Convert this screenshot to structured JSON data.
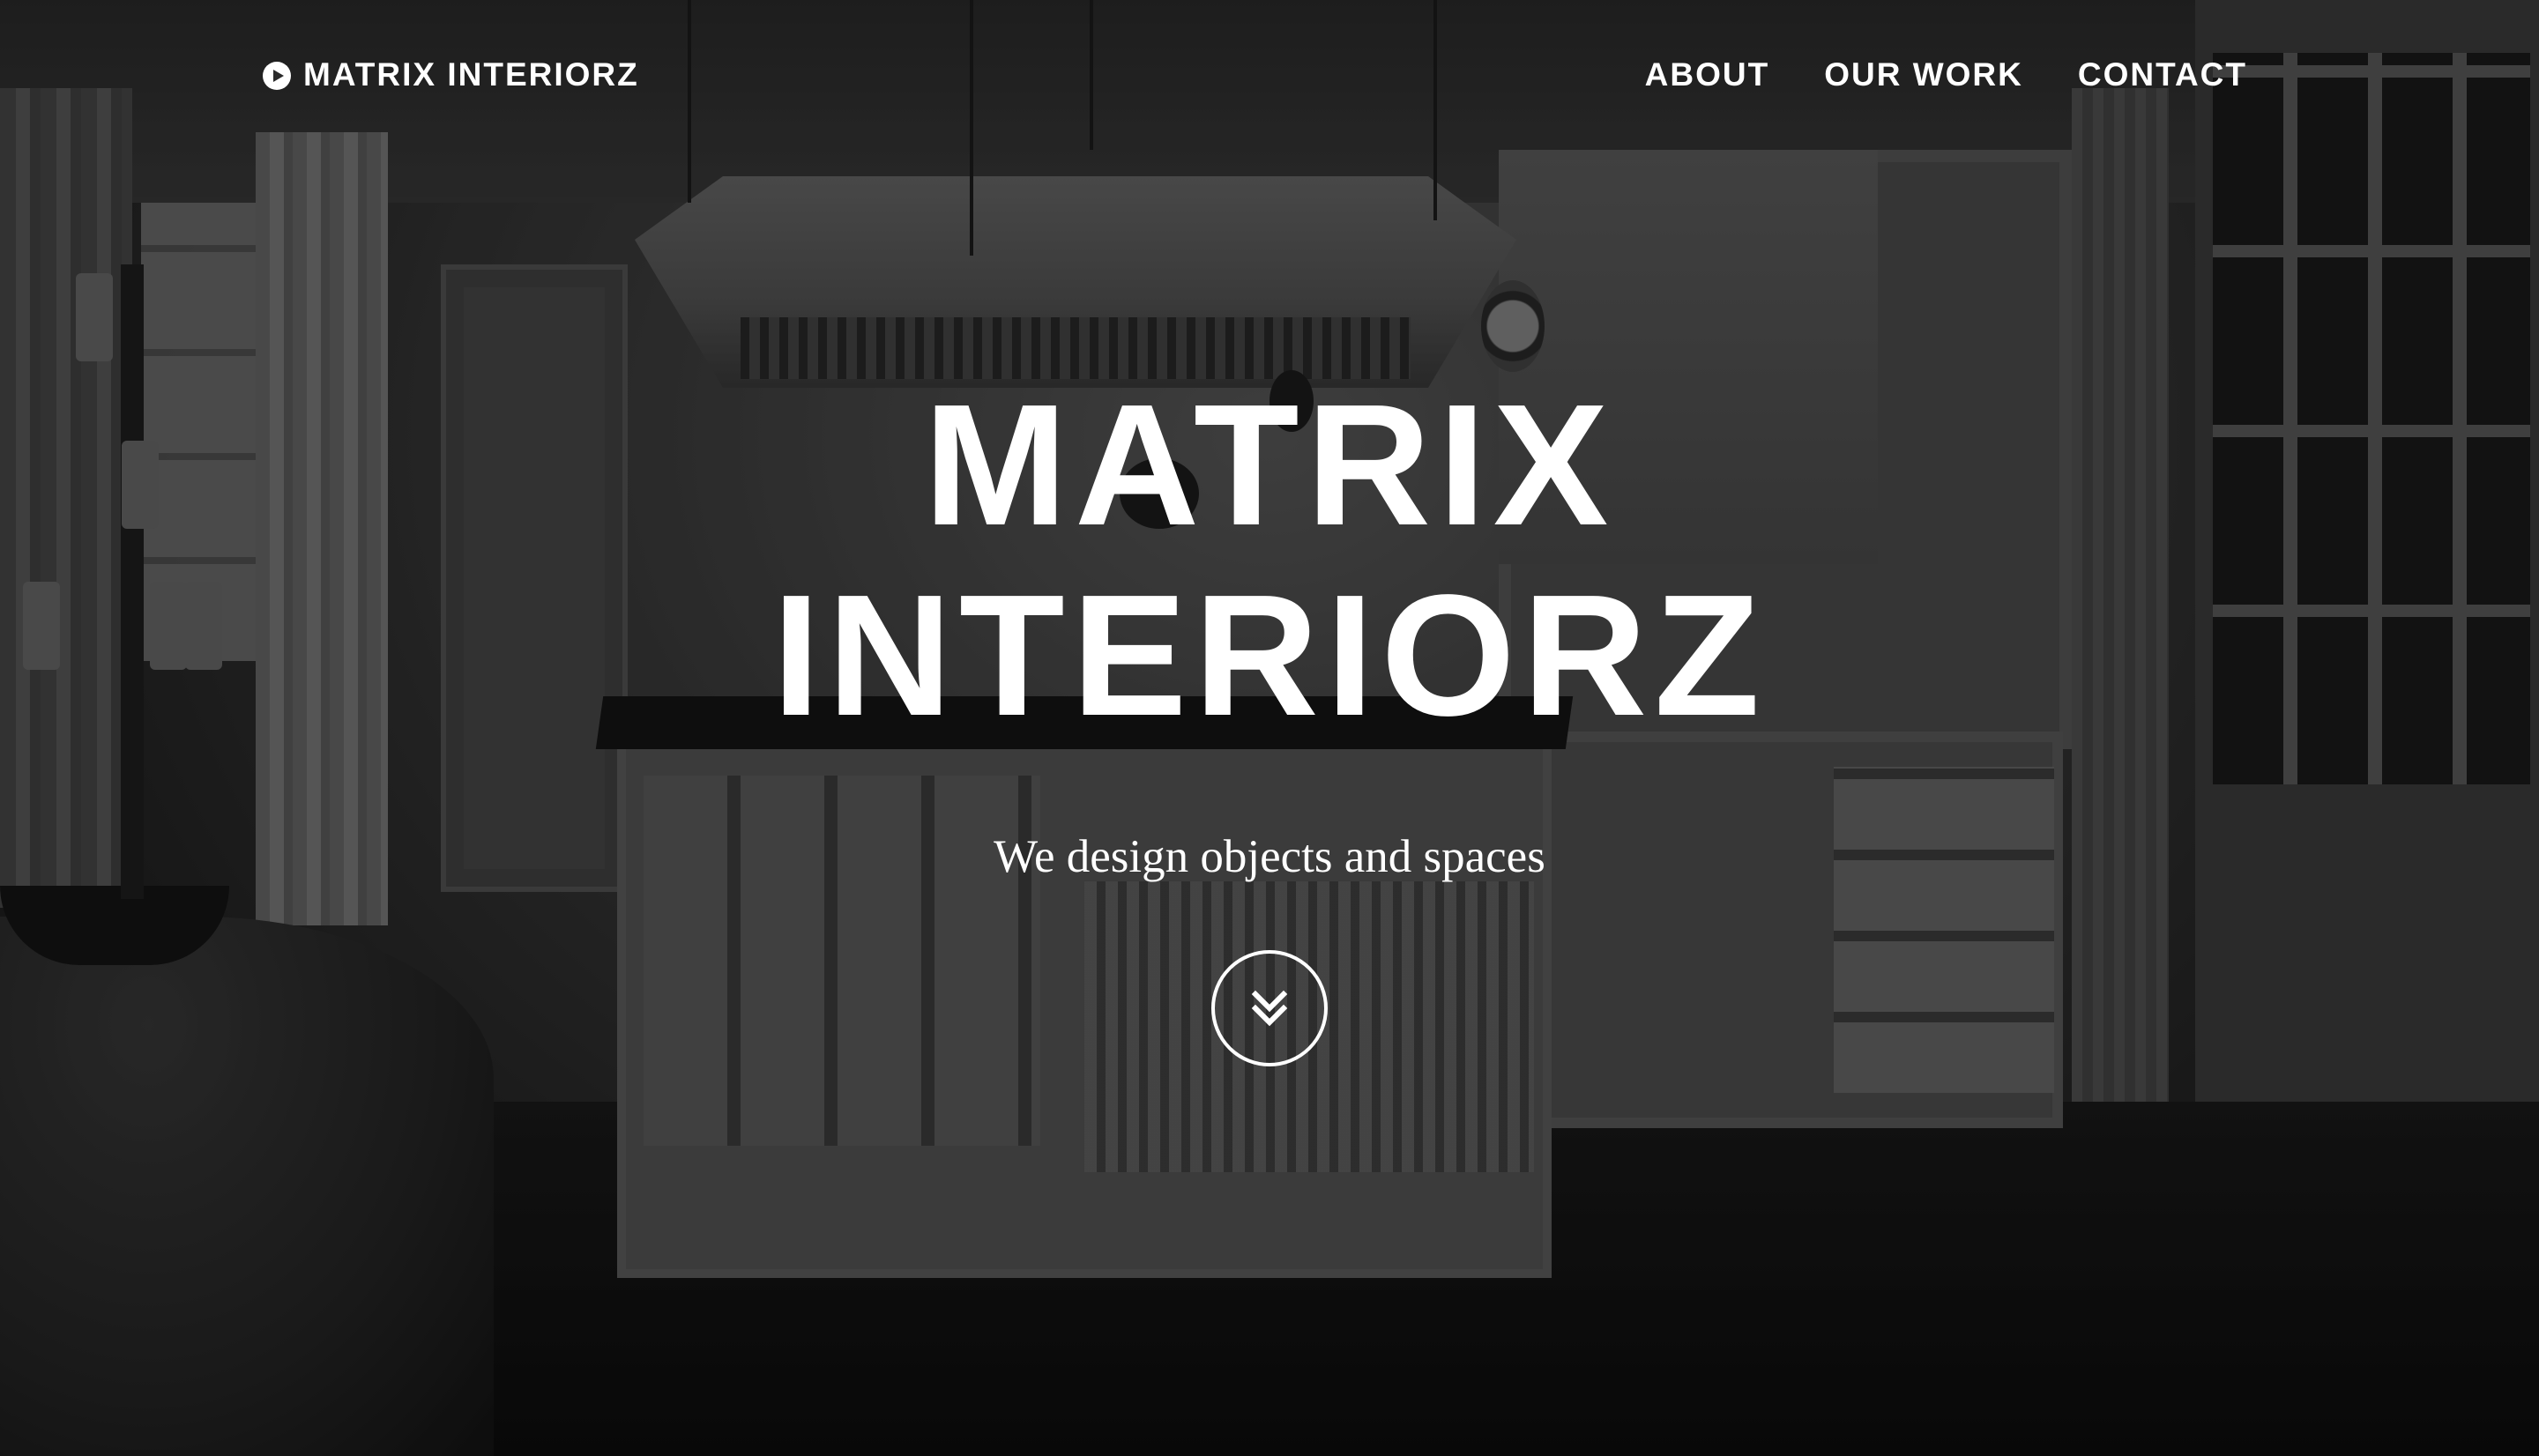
{
  "nav": {
    "brand_label": "MATRIX INTERIORZ",
    "brand_icon": "play-circle-icon",
    "links": [
      {
        "label": "ABOUT"
      },
      {
        "label": "OUR WORK"
      },
      {
        "label": "CONTACT"
      }
    ]
  },
  "hero": {
    "title_line1": "MATRIX",
    "title_line2": "INTERIORZ",
    "subtitle": "We design objects and spaces",
    "scroll_icon": "double-chevron-down-icon"
  },
  "colors": {
    "text": "#ffffff",
    "overlay": "#000000"
  }
}
